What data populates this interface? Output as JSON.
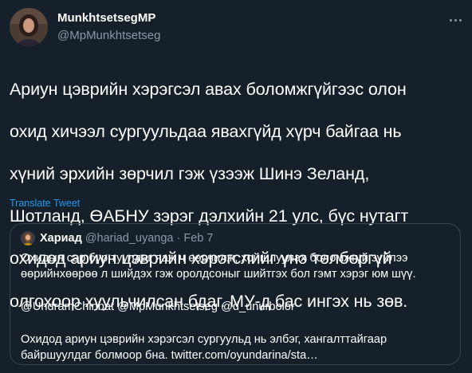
{
  "tweet": {
    "display_name": "MunkhtsetsegMP",
    "handle": "@MpMunkhtsetseg",
    "text_lines": [
      "Ариун цэврийн хэрэгсэл авах боломжгүйгээс олон",
      "охид хичээл сургуульдаа явахгүйд хүрч байгаа нь",
      "хүний эрхийн зөрчил гэж үзээж Шинэ Зеланд,",
      "Шотланд, ӨАБНУ зэрэг дэлхийн 21 улс, бүс нутагт",
      "охидод ариун цэврийн хэрэгслийг үнэ төлбөргүй",
      "олгохоор хуульчилсан бдаг. МУ-д бас ингэх нь зөв."
    ],
    "translate_label": "Translate Tweet",
    "more_icon": "more-dots-icon"
  },
  "quote": {
    "display_name": "Хариад",
    "handle": "@hariad_uyanga",
    "separator": "·",
    "date": "Feb 7",
    "lines": [
      "Охидын сар бүр туулдаг яаж ч өөрчилж, хойшлуулах боломжгүй зүйлээ",
      "өөрийнхөөрөө л шийдэх гэж оролдсоныг шийтгэх бол гэмт хэрэг юм шүү.",
      "",
      "@UndramChinbat @MpMunkhtsetseg @d_unurbolor",
      "",
      "Охидод ариун цэврийн хэрэгсэл сургуульд нь элбэг, хангалттайгаар",
      "байршуулдаг болмоор бна. twitter.com/oyundarina/sta…"
    ]
  },
  "colors": {
    "background": "#15202b",
    "text": "#ffffff",
    "secondary": "#8b98a5",
    "link": "#1d9bf0",
    "border": "#38444d"
  }
}
